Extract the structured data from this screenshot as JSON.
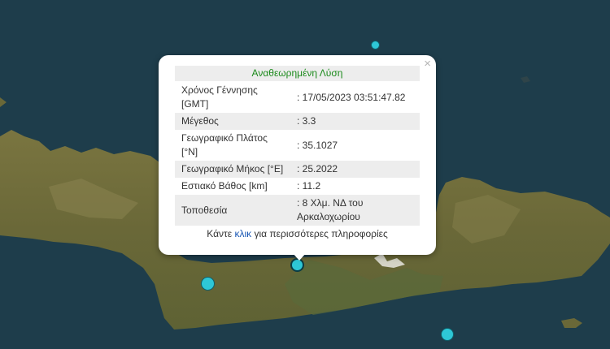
{
  "popup": {
    "title": "Αναθεωρημένη Λύση",
    "close_glyph": "×",
    "rows": [
      {
        "label": "Χρόνος Γέννησης [GMT]",
        "value": ": 17/05/2023 03:51:47.82"
      },
      {
        "label": "Μέγεθος",
        "value": ": 3.3"
      },
      {
        "label": "Γεωγραφικό Πλάτος [°N]",
        "value": ": 35.1027"
      },
      {
        "label": "Γεωγραφικό Μήκος [°E]",
        "value": ": 25.2022"
      },
      {
        "label": "Εστιακό Βάθος [km]",
        "value": ": 11.2"
      },
      {
        "label": "Τοποθεσία",
        "value": ": 8 Χλμ. ΝΔ του Αρκαλοχωρίου"
      }
    ],
    "footer_before": "Κάντε ",
    "footer_link": "κλικ",
    "footer_after": " για περισσότερες πληροφορίες"
  },
  "colors": {
    "sea": "#1e3d4b",
    "land": "#6e6a3c",
    "marker_fill": "#2ec7d6",
    "title_text": "#1b8a1b",
    "link": "#1a58b5"
  },
  "markers": [
    {
      "name": "earthquake-marker-north"
    },
    {
      "name": "earthquake-marker-selected"
    },
    {
      "name": "earthquake-marker-west"
    },
    {
      "name": "earthquake-marker-south"
    }
  ]
}
